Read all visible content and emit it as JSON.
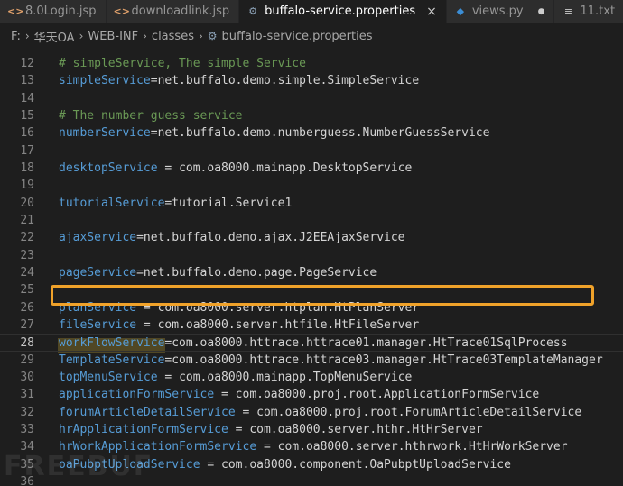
{
  "tabs": [
    {
      "label": "8.0Login.jsp",
      "icon": "jsp-file-icon",
      "active": false
    },
    {
      "label": "downloadlink.jsp",
      "icon": "jsp-file-icon",
      "active": false
    },
    {
      "label": "buffalo-service.properties",
      "icon": "gear-file-icon",
      "active": true,
      "close": "×"
    },
    {
      "label": "views.py",
      "icon": "python-file-icon",
      "active": false,
      "modified": "●"
    },
    {
      "label": "11.txt",
      "icon": "text-file-icon",
      "active": false
    }
  ],
  "breadcrumb": [
    "F:",
    "华天OA",
    "WEB-INF",
    "classes",
    "buffalo-service.properties"
  ],
  "editor": {
    "current_line": 28,
    "lines": [
      {
        "n": "12",
        "comment": "# simpleService, The simple Service"
      },
      {
        "n": "13",
        "key": "simpleService",
        "sep": "=",
        "value": "net.buffalo.demo.simple.SimpleService"
      },
      {
        "n": "14"
      },
      {
        "n": "15",
        "comment": "# The number guess service"
      },
      {
        "n": "16",
        "key": "numberService",
        "sep": "=",
        "value": "net.buffalo.demo.numberguess.NumberGuessService"
      },
      {
        "n": "17"
      },
      {
        "n": "18",
        "key": "desktopService",
        "sep": " = ",
        "value": "com.oa8000.mainapp.DesktopService"
      },
      {
        "n": "19"
      },
      {
        "n": "20",
        "key": "tutorialService",
        "sep": "=",
        "value": "tutorial.Service1"
      },
      {
        "n": "21"
      },
      {
        "n": "22",
        "key": "ajaxService",
        "sep": "=",
        "value": "net.buffalo.demo.ajax.J2EEAjaxService"
      },
      {
        "n": "23"
      },
      {
        "n": "24",
        "key": "pageService",
        "sep": "=",
        "value": "net.buffalo.demo.page.PageService"
      },
      {
        "n": "25"
      },
      {
        "n": "26",
        "key": "planService",
        "sep": " = ",
        "value": "com.oa8000.server.htplan.HtPlanServer"
      },
      {
        "n": "27",
        "key": "fileService",
        "sep": " = ",
        "value": "com.oa8000.server.htfile.HtFileServer"
      },
      {
        "n": "28",
        "key": "workFlowService",
        "sep": "=",
        "value": "com.oa8000.httrace.httrace01.manager.HtTrace01SqlProcess"
      },
      {
        "n": "29",
        "key": "TemplateService",
        "sep": "=",
        "value": "com.oa8000.httrace.httrace03.manager.HtTrace03TemplateManager"
      },
      {
        "n": "30",
        "key": "topMenuService",
        "sep": " = ",
        "value": "com.oa8000.mainapp.TopMenuService"
      },
      {
        "n": "31",
        "key": "applicationFormService",
        "sep": " = ",
        "value": "com.oa8000.proj.root.ApplicationFormService"
      },
      {
        "n": "32",
        "key": "forumArticleDetailService",
        "sep": " = ",
        "value": "com.oa8000.proj.root.ForumArticleDetailService"
      },
      {
        "n": "33",
        "key": "hrApplicationFormService",
        "sep": " = ",
        "value": "com.oa8000.server.hthr.HtHrServer"
      },
      {
        "n": "34",
        "key": "hrWorkApplicationFormService",
        "sep": " = ",
        "value": "com.oa8000.server.hthrwork.HtHrWorkServer"
      },
      {
        "n": "35",
        "key": "oaPubptUploadService",
        "sep": " = ",
        "value": "com.oa8000.component.OaPubptUploadService"
      },
      {
        "n": "36"
      }
    ]
  },
  "watermark": "FREEBUF",
  "colors": {
    "highlight_border": "#f0a22a",
    "key": "#569cd6",
    "comment": "#6a9955"
  }
}
